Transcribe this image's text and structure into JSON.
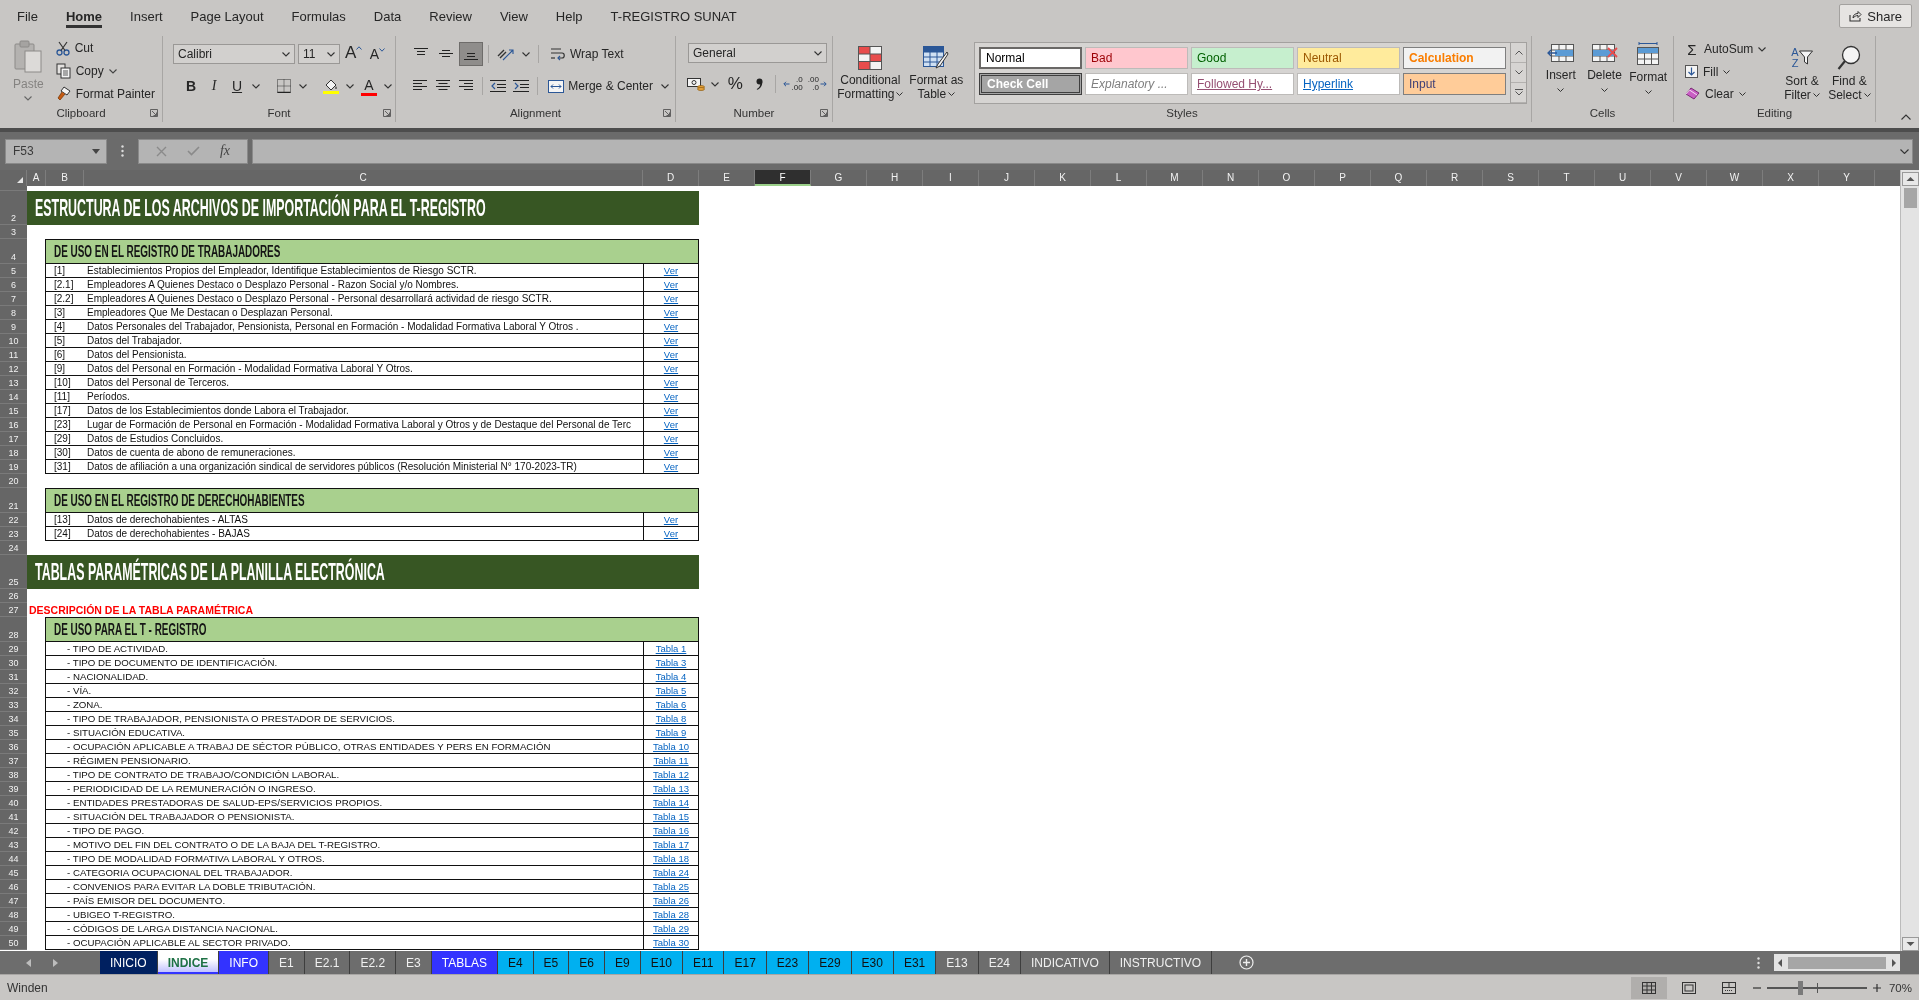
{
  "menu_tabs": [
    {
      "label": "File",
      "selected": false
    },
    {
      "label": "Home",
      "selected": true
    },
    {
      "label": "Insert",
      "selected": false
    },
    {
      "label": "Page Layout",
      "selected": false
    },
    {
      "label": "Formulas",
      "selected": false
    },
    {
      "label": "Data",
      "selected": false
    },
    {
      "label": "Review",
      "selected": false
    },
    {
      "label": "View",
      "selected": false
    },
    {
      "label": "Help",
      "selected": false
    },
    {
      "label": "T-REGISTRO SUNAT",
      "selected": false
    }
  ],
  "share_button": "Share",
  "clipboard": {
    "title": "Clipboard",
    "paste": {
      "label": "Paste",
      "disabled": true
    },
    "cut": "Cut",
    "copy": "Copy",
    "format_painter": "Format Painter"
  },
  "font": {
    "title": "Font",
    "font_name": "Calibri",
    "font_size": "11",
    "grow": "A",
    "shrink": "A",
    "bold": "B",
    "italic": "I",
    "underline": "U",
    "font_color": "A"
  },
  "alignment": {
    "title": "Alignment",
    "vertical_align": [
      {
        "selected": false
      },
      {
        "selected": false
      },
      {
        "selected": true
      }
    ],
    "wrap_text": "Wrap Text",
    "merge_center": "Merge & Center"
  },
  "number": {
    "title": "Number",
    "format": "General",
    "percent": "%",
    "increase_decimal": [
      ".0",
      ".00"
    ],
    "decrease_decimal": [
      ".00",
      ".0"
    ]
  },
  "styles": {
    "title": "Styles",
    "conditional_formatting": "Conditional Formatting",
    "format_as_table": "Format as Table",
    "gallery": [
      {
        "label": "Normal",
        "kind": "normal",
        "color": "#ffffff",
        "selected": true
      },
      {
        "label": "Bad",
        "kind": "bad",
        "color": "#ffc7ce",
        "selected": false
      },
      {
        "label": "Good",
        "kind": "good",
        "color": "#c6efce",
        "selected": false
      },
      {
        "label": "Neutral",
        "kind": "neutral",
        "color": "#ffeb9c",
        "selected": false
      },
      {
        "label": "Calculation",
        "kind": "calculation",
        "color": "#f2f2f2",
        "selected": false
      },
      {
        "label": "Check Cell",
        "kind": "check",
        "color": "#a5a5a5",
        "selected": false
      },
      {
        "label": "Explanatory ...",
        "kind": "explanatory",
        "color": "#ffffff",
        "selected": false
      },
      {
        "label": "Followed Hy...",
        "kind": "followed",
        "color": "#ffffff",
        "selected": false
      },
      {
        "label": "Hyperlink",
        "kind": "hyperlink",
        "color": "#ffffff",
        "selected": false
      },
      {
        "label": "Input",
        "kind": "input",
        "color": "#ffcc99",
        "selected": false
      }
    ]
  },
  "cells": {
    "title": "Cells",
    "insert": "Insert",
    "delete": "Delete",
    "format": "Format"
  },
  "editing": {
    "title": "Editing",
    "autosum_symbol": "Σ",
    "autosum": "AutoSum",
    "fill": "Fill",
    "clear": "Clear",
    "sort_letters": [
      "A",
      "Z"
    ],
    "sort_filter": "Sort & Filter",
    "find_select": "Find & Select"
  },
  "formula_bar": {
    "name_box": "F53",
    "function_symbol": "fx"
  },
  "columns": [
    {
      "label": "A",
      "selected": false
    },
    {
      "label": "B",
      "selected": false
    },
    {
      "label": "C",
      "selected": false
    },
    {
      "label": "D",
      "selected": false
    },
    {
      "label": "E",
      "selected": false
    },
    {
      "label": "F",
      "selected": true
    },
    {
      "label": "G",
      "selected": false
    },
    {
      "label": "H",
      "selected": false
    },
    {
      "label": "I",
      "selected": false
    },
    {
      "label": "J",
      "selected": false
    },
    {
      "label": "K",
      "selected": false
    },
    {
      "label": "L",
      "selected": false
    },
    {
      "label": "M",
      "selected": false
    },
    {
      "label": "N",
      "selected": false
    },
    {
      "label": "O",
      "selected": false
    },
    {
      "label": "P",
      "selected": false
    },
    {
      "label": "Q",
      "selected": false
    },
    {
      "label": "R",
      "selected": false
    },
    {
      "label": "S",
      "selected": false
    },
    {
      "label": "T",
      "selected": false
    },
    {
      "label": "U",
      "selected": false
    },
    {
      "label": "V",
      "selected": false
    },
    {
      "label": "W",
      "selected": false
    },
    {
      "label": "X",
      "selected": false
    },
    {
      "label": "Y",
      "selected": false
    }
  ],
  "rows": [
    {
      "kind": "spacer"
    },
    {
      "number": "2",
      "kind": "title",
      "text": "ESTRUCTURA DE LOS ARCHIVOS DE IMPORTACIÓN PARA EL T-REGISTRO"
    },
    {
      "number": "3",
      "kind": "blank"
    },
    {
      "number": "4",
      "kind": "section",
      "text": "DE USO EN EL REGISTRO DE TRABAJADORES"
    },
    {
      "number": "5",
      "kind": "item",
      "code": "[1]",
      "text": "Establecimientos Propios del Empleador, Identifique Establecimientos de Riesgo SCTR.",
      "link": "Ver"
    },
    {
      "number": "6",
      "kind": "item",
      "code": "[2.1]",
      "text": "Empleadores A Quienes Destaco o Desplazo Personal - Razon Social y/o Nombres.",
      "link": "Ver"
    },
    {
      "number": "7",
      "kind": "item",
      "code": "[2.2]",
      "text": "Empleadores A Quienes Destaco o Desplazo Personal - Personal desarrollará actividad de riesgo SCTR.",
      "link": "Ver"
    },
    {
      "number": "8",
      "kind": "item",
      "code": "[3]",
      "text": "Empleadores Que Me Destacan o Desplazan Personal.",
      "link": "Ver"
    },
    {
      "number": "9",
      "kind": "item",
      "code": "[4]",
      "text": "Datos Personales del Trabajador, Pensionista, Personal en Formación - Modalidad Formativa Laboral Y Otros .",
      "link": "Ver"
    },
    {
      "number": "10",
      "kind": "item",
      "code": "[5]",
      "text": "Datos del Trabajador.",
      "link": "Ver"
    },
    {
      "number": "11",
      "kind": "item",
      "code": "[6]",
      "text": "Datos del Pensionista.",
      "link": "Ver"
    },
    {
      "number": "12",
      "kind": "item",
      "code": "[9]",
      "text": "Datos del Personal en Formación - Modalidad Formativa Laboral Y Otros.",
      "link": "Ver"
    },
    {
      "number": "13",
      "kind": "item",
      "code": "[10]",
      "text": "Datos del Personal de Terceros.",
      "link": "Ver"
    },
    {
      "number": "14",
      "kind": "item",
      "code": "[11]",
      "text": "Períodos.",
      "link": "Ver"
    },
    {
      "number": "15",
      "kind": "item",
      "code": "[17]",
      "text": "Datos de los Establecimientos donde Labora el Trabajador.",
      "link": "Ver"
    },
    {
      "number": "16",
      "kind": "item",
      "code": "[23]",
      "text": "Lugar de Formación de Personal en Formación - Modalidad Formativa Laboral y Otros y de Destaque del Personal de Terc",
      "link": "Ver"
    },
    {
      "number": "17",
      "kind": "item",
      "code": "[29]",
      "text": "Datos de Estudios Concluidos.",
      "link": "Ver"
    },
    {
      "number": "18",
      "kind": "item",
      "code": "[30]",
      "text": "Datos de cuenta de abono de remuneraciones.",
      "link": "Ver"
    },
    {
      "number": "19",
      "kind": "item",
      "code": "[31]",
      "text": "Datos de afiliación a una organización sindical de servidores públicos (Resolución Ministerial N° 170-2023-TR)",
      "link": "Ver"
    },
    {
      "number": "20",
      "kind": "blank"
    },
    {
      "number": "21",
      "kind": "section",
      "text": "DE USO EN EL REGISTRO DE DERECHOHABIENTES"
    },
    {
      "number": "22",
      "kind": "item",
      "code": "[13]",
      "text": "Datos de derechohabientes - ALTAS",
      "link": "Ver"
    },
    {
      "number": "23",
      "kind": "item",
      "code": "[24]",
      "text": "Datos de derechohabientes - BAJAS",
      "link": "Ver"
    },
    {
      "number": "24",
      "kind": "blank"
    },
    {
      "number": "25",
      "kind": "title",
      "text": "TABLAS PARAMÉTRICAS DE LA PLANILLA ELECTRÓNICA"
    },
    {
      "number": "26",
      "kind": "blank"
    },
    {
      "number": "27",
      "kind": "note",
      "text": "DESCRIPCIÓN DE LA TABLA PARAMÉTRICA"
    },
    {
      "number": "28",
      "kind": "section",
      "text": "DE USO PARA EL T - REGISTRO"
    },
    {
      "number": "29",
      "kind": "param",
      "text": "- TIPO DE ACTIVIDAD.",
      "link": "Tabla 1"
    },
    {
      "number": "30",
      "kind": "param",
      "text": "- TIPO DE DOCUMENTO DE IDENTIFICACIÓN.",
      "link": "Tabla 3"
    },
    {
      "number": "31",
      "kind": "param",
      "text": "- NACIONALIDAD.",
      "link": "Tabla 4"
    },
    {
      "number": "32",
      "kind": "param",
      "text": "- VÍA.",
      "link": "Tabla 5"
    },
    {
      "number": "33",
      "kind": "param",
      "text": "- ZONA.",
      "link": "Tabla 6"
    },
    {
      "number": "34",
      "kind": "param",
      "text": "- TIPO DE TRABAJADOR, PENSIONISTA O PRESTADOR DE SERVICIOS.",
      "link": "Tabla 8"
    },
    {
      "number": "35",
      "kind": "param",
      "text": "- SITUACIÓN EDUCATIVA.",
      "link": "Tabla 9"
    },
    {
      "number": "36",
      "kind": "param",
      "text": "- OCUPACIÓN APLICABLE A TRABAJ DE SÉCTOR PÚBLICO, OTRAS ENTIDADES Y PERS EN FORMACIÓN",
      "link": "Tabla 10"
    },
    {
      "number": "37",
      "kind": "param",
      "text": "- RÉGIMEN PENSIONARIO.",
      "link": "Tabla 11"
    },
    {
      "number": "38",
      "kind": "param",
      "text": "- TIPO DE CONTRATO DE TRABAJO/CONDICIÓN LABORAL.",
      "link": "Tabla 12"
    },
    {
      "number": "39",
      "kind": "param",
      "text": "- PERIODICIDAD DE LA REMUNERACIÓN O INGRESO.",
      "link": "Tabla 13"
    },
    {
      "number": "40",
      "kind": "param",
      "text": "- ENTIDADES PRESTADORAS DE SALUD-EPS/SERVICIOS PROPIOS.",
      "link": "Tabla 14"
    },
    {
      "number": "41",
      "kind": "param",
      "text": "- SITUACIÓN DEL TRABAJADOR O PENSIONISTA.",
      "link": "Tabla 15"
    },
    {
      "number": "42",
      "kind": "param",
      "text": "- TIPO DE PAGO.",
      "link": "Tabla 16"
    },
    {
      "number": "43",
      "kind": "param",
      "text": "- MOTIVO DEL FIN DEL CONTRATO O DE LA BAJA DEL T-REGISTRO.",
      "link": "Tabla 17"
    },
    {
      "number": "44",
      "kind": "param",
      "text": "- TIPO DE MODALIDAD FORMATIVA LABORAL Y OTROS.",
      "link": "Tabla 18"
    },
    {
      "number": "45",
      "kind": "param",
      "text": "- CATEGORIA OCUPACIONAL DEL TRABAJADOR.",
      "link": "Tabla 24"
    },
    {
      "number": "46",
      "kind": "param",
      "text": "- CONVENIOS PARA EVITAR LA DOBLE TRIBUTACIÓN.",
      "link": "Tabla 25"
    },
    {
      "number": "47",
      "kind": "param",
      "text": "- PAÍS EMISOR DEL DOCUMENTO.",
      "link": "Tabla 26"
    },
    {
      "number": "48",
      "kind": "param",
      "text": "- UBIGEO T-REGISTRO.",
      "link": "Tabla 28"
    },
    {
      "number": "49",
      "kind": "param",
      "text": "- CÓDIGOS DE LARGA DISTANCIA NACIONAL.",
      "link": "Tabla 29"
    },
    {
      "number": "50",
      "kind": "param",
      "text": "- OCUPACIÓN APLICABLE AL SECTOR PRIVADO.",
      "link": "Tabla 30"
    }
  ],
  "sheet_tabs": [
    {
      "label": "INICIO",
      "selected": false,
      "color": "#002060"
    },
    {
      "label": "INDICE",
      "selected": true,
      "color": "#3333ff"
    },
    {
      "label": "INFO",
      "selected": false,
      "color": "#3333ff"
    },
    {
      "label": "E1",
      "selected": false
    },
    {
      "label": "E2.1",
      "selected": false
    },
    {
      "label": "E2.2",
      "selected": false
    },
    {
      "label": "E3",
      "selected": false
    },
    {
      "label": "TABLAS",
      "selected": false,
      "color": "#3333ff"
    },
    {
      "label": "E4",
      "selected": false,
      "color": "#00b0f0"
    },
    {
      "label": "E5",
      "selected": false,
      "color": "#00b0f0"
    },
    {
      "label": "E6",
      "selected": false,
      "color": "#00b0f0"
    },
    {
      "label": "E9",
      "selected": false,
      "color": "#00b0f0"
    },
    {
      "label": "E10",
      "selected": false,
      "color": "#00b0f0"
    },
    {
      "label": "E11",
      "selected": false,
      "color": "#00b0f0"
    },
    {
      "label": "E17",
      "selected": false,
      "color": "#00b0f0"
    },
    {
      "label": "E23",
      "selected": false,
      "color": "#00b0f0"
    },
    {
      "label": "E29",
      "selected": false,
      "color": "#00b0f0"
    },
    {
      "label": "E30",
      "selected": false,
      "color": "#00b0f0"
    },
    {
      "label": "E31",
      "selected": false,
      "color": "#00b0f0"
    },
    {
      "label": "E13",
      "selected": false
    },
    {
      "label": "E24",
      "selected": false
    },
    {
      "label": "INDICATIVO",
      "selected": false
    },
    {
      "label": "INSTRUCTIVO",
      "selected": false
    }
  ],
  "status_bar": {
    "text": "Winden",
    "zoom": "70%",
    "zoom_slider": {
      "level": 0.33
    }
  }
}
